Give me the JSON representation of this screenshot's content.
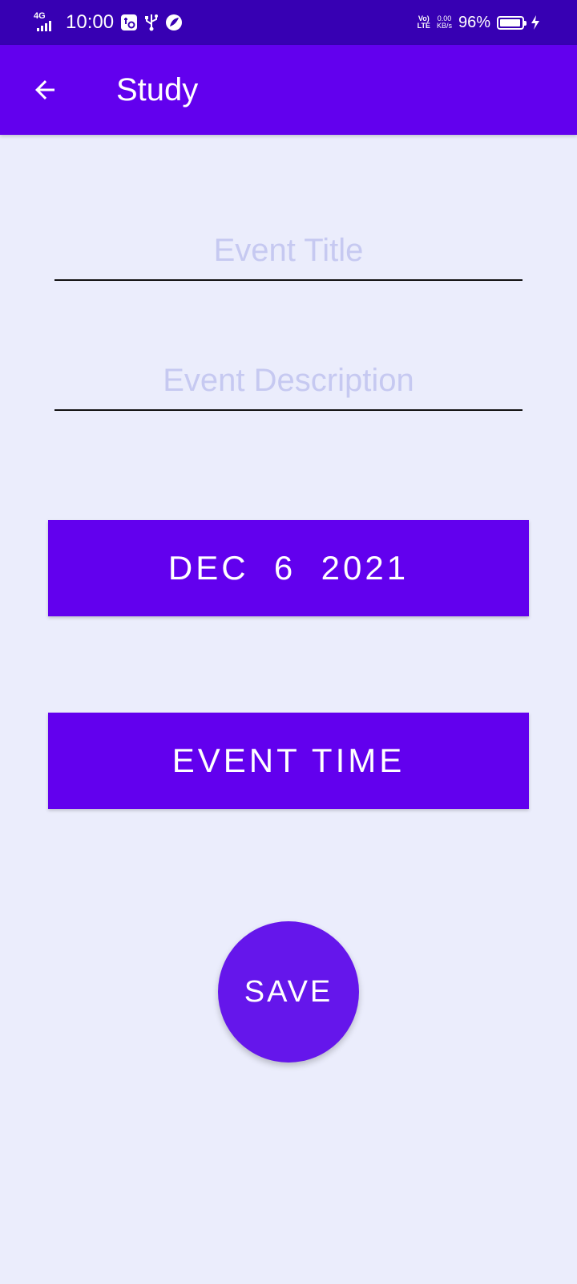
{
  "status_bar": {
    "network": "4G",
    "time": "10:00",
    "volte_top": "Vo)",
    "volte_bottom": "LTE",
    "speed_value": "0.00",
    "speed_unit": "KB/s",
    "battery_percent": "96%",
    "battery_level": 0.96,
    "icons": [
      "signal-icon",
      "usb-debug-icon",
      "usb-icon",
      "leaf-icon",
      "battery-icon",
      "charging-icon"
    ]
  },
  "app_bar": {
    "title": "Study",
    "back_icon": "arrow-left-icon"
  },
  "form": {
    "title_field": {
      "value": "",
      "placeholder": "Event Title"
    },
    "description_field": {
      "value": "",
      "placeholder": "Event Description"
    },
    "date_button_label": "DEC  6  2021",
    "time_button_label": "EVENT TIME",
    "save_button_label": "SAVE"
  },
  "colors": {
    "status_bar": "#3700b3",
    "primary": "#6200ee",
    "background": "#ebedfc",
    "placeholder": "#c6c9f1",
    "on_primary": "#ffffff"
  }
}
